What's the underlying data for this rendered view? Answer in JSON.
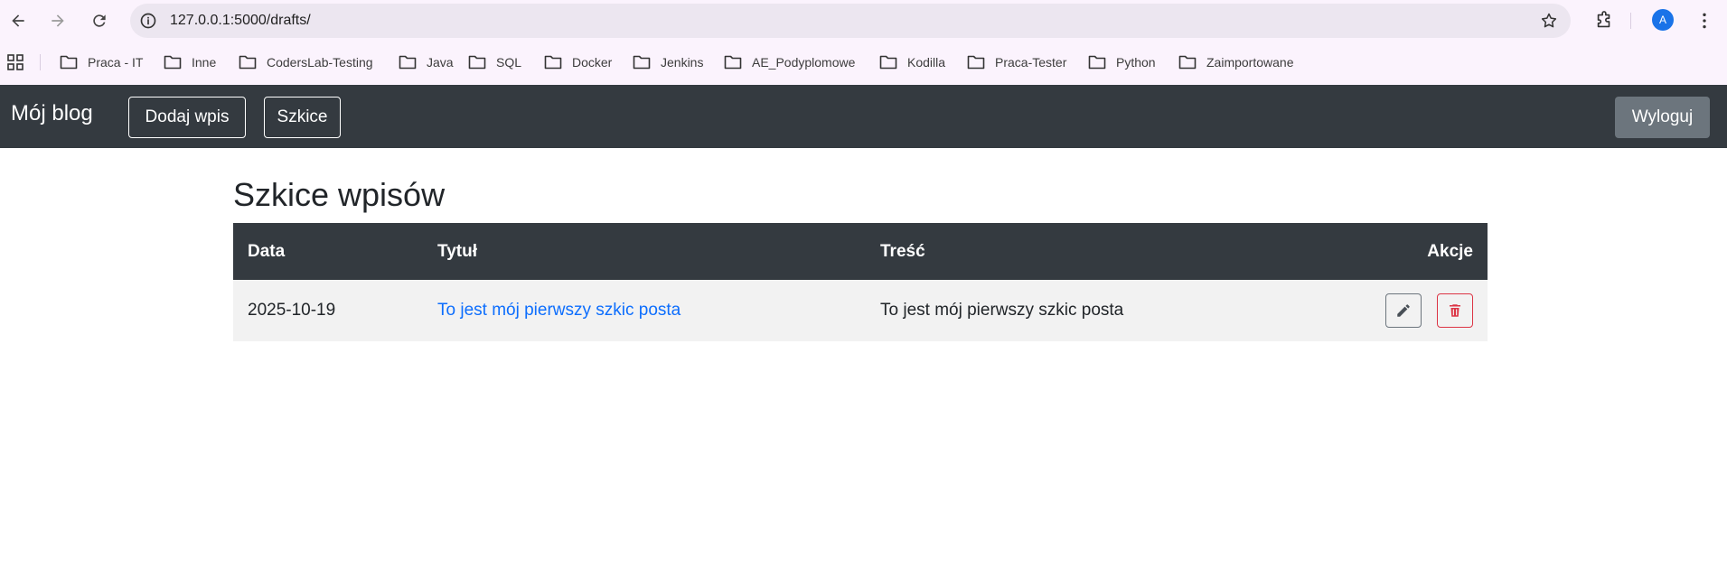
{
  "browser": {
    "url": "127.0.0.1:5000/drafts/",
    "profile_initial": "A",
    "bookmarks": [
      {
        "label": "Praca - IT",
        "icon": "folder-icon"
      },
      {
        "label": "Inne",
        "icon": "folder-icon"
      },
      {
        "label": "CodersLab-Testing",
        "icon": "folder-icon"
      },
      {
        "label": "Java",
        "icon": "folder-icon"
      },
      {
        "label": "SQL",
        "icon": "folder-icon"
      },
      {
        "label": "Docker",
        "icon": "folder-icon"
      },
      {
        "label": "Jenkins",
        "icon": "folder-icon"
      },
      {
        "label": "AE_Podyplomowe",
        "icon": "folder-icon"
      },
      {
        "label": "Kodilla",
        "icon": "folder-icon"
      },
      {
        "label": "Praca-Tester",
        "icon": "folder-icon"
      },
      {
        "label": "Python",
        "icon": "folder-icon"
      },
      {
        "label": "Zaimportowane",
        "icon": "folder-icon"
      }
    ]
  },
  "navbar": {
    "brand": "Mój blog",
    "add_post_label": "Dodaj wpis",
    "drafts_label": "Szkice",
    "logout_label": "Wyloguj"
  },
  "main": {
    "title": "Szkice wpisów",
    "table": {
      "headers": {
        "date": "Data",
        "title": "Tytuł",
        "content": "Treść",
        "actions": "Akcje"
      },
      "rows": [
        {
          "date": "2025-10-19",
          "title": "To jest mój pierwszy szkic posta",
          "content": "To jest mój pierwszy szkic posta",
          "edit_icon": "pencil-icon",
          "delete_icon": "trash-icon"
        }
      ]
    }
  },
  "colors": {
    "navbar_bg": "#343a40",
    "link": "#0d6efd",
    "danger": "#dc3545",
    "secondary": "#6c757d"
  }
}
